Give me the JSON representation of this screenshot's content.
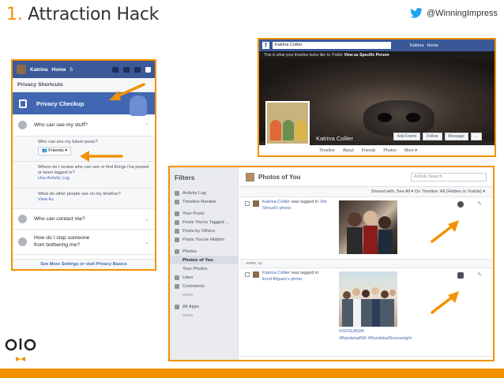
{
  "slide": {
    "number": "1.",
    "title": "Attraction Hack",
    "twitter_handle": "@WinningImpress",
    "accent_color": "#f39200",
    "twitter_color": "#1da1f2"
  },
  "privacy_panel": {
    "user": "Katrina",
    "home_label": "Home",
    "home_count": "5",
    "header": "Privacy Shortcuts",
    "checkup": "Privacy Checkup",
    "sections": [
      {
        "label": "Who can see my stuff?",
        "icon": "globe-icon"
      },
      {
        "label": "Who can contact me?",
        "icon": "person-icon"
      },
      {
        "label": "How do I stop someone from bothering me?",
        "icon": "block-icon"
      }
    ],
    "sub_items": [
      {
        "text": "Who can see my future posts?",
        "button": "Friends"
      },
      {
        "text": "Where do I review who can see or find things I've posted or been tagged in?",
        "link": "Use Activity Log"
      },
      {
        "text": "What do other people see on my timeline?",
        "link": "View As"
      }
    ],
    "footer": "See More Settings or visit Privacy Basics"
  },
  "profile_panel": {
    "search_value": "Katrina Collier",
    "nav_user": "Katrina",
    "nav_home": "Home",
    "view_as_text": "This is what your timeline looks like to: Public",
    "view_as_link": "View as Specific Person",
    "name": "Katrina Collier",
    "actions": [
      "Add Friend",
      "Follow",
      "Message",
      "..."
    ],
    "tabs": [
      "Timeline",
      "About",
      "Friends",
      "Photos",
      "More"
    ]
  },
  "activity_panel": {
    "sidebar_title": "Filters",
    "sidebar_items": [
      {
        "label": "Activity Log",
        "level": 0
      },
      {
        "label": "Timeline Review",
        "level": 0
      },
      {
        "label": "Your Posts",
        "level": 0
      },
      {
        "label": "Posts You're Tagged ...",
        "level": 0
      },
      {
        "label": "Posts by Others",
        "level": 0
      },
      {
        "label": "Posts You've Hidden",
        "level": 0
      },
      {
        "label": "Photos",
        "level": 0
      },
      {
        "label": "Photos of You",
        "level": 1,
        "selected": true
      },
      {
        "label": "Your Photos",
        "level": 1
      },
      {
        "label": "Likes",
        "level": 0
      },
      {
        "label": "Comments",
        "level": 0
      },
      {
        "label": "MORE",
        "level": 2
      },
      {
        "label": "All Apps",
        "level": 0
      },
      {
        "label": "MORE",
        "level": 2
      }
    ],
    "title": "Photos of You",
    "search_placeholder": "Activity Search",
    "filters": "Shared with: See All ▾   On Timeline: All (Hidden or Visible) ▾",
    "entries": [
      {
        "author": "Katrina Collier",
        "middle": " was tagged in ",
        "target": "Jim Stroud's photo."
      },
      {
        "author": "Katrina Collier",
        "middle": " was tagged in ",
        "target": "Errol Rigues's photo."
      }
    ],
    "date_label": "APRIL 14",
    "hashtags": [
      "#SOSUASIA",
      "#RandstadSR #RandstadSourceright"
    ]
  }
}
